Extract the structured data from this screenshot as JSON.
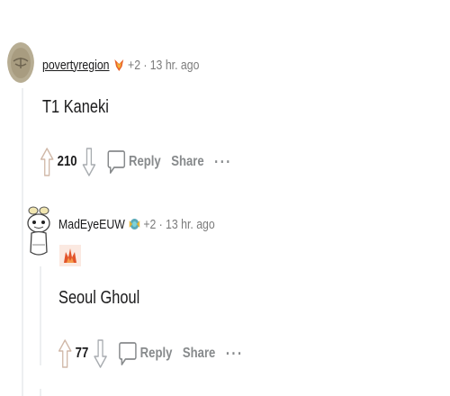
{
  "comment1": {
    "username": "povertyregion",
    "award_count": "+2",
    "time": "13 hr. ago",
    "body": "T1 Kaneki",
    "score": "210",
    "reply_label": "Reply",
    "share_label": "Share",
    "more_label": "···"
  },
  "comment2": {
    "username": "MadEyeEUW",
    "award_count": "+2",
    "time": "13 hr. ago",
    "body": "Seoul Ghoul",
    "score": "77",
    "reply_label": "Reply",
    "share_label": "Share",
    "more_label": "···"
  },
  "meta_separator": "·",
  "colors": {
    "thread_line": "#edeff1",
    "meta_text": "#7c7c7c",
    "action_text": "#878a8c",
    "body_text": "#1a1a1b"
  }
}
